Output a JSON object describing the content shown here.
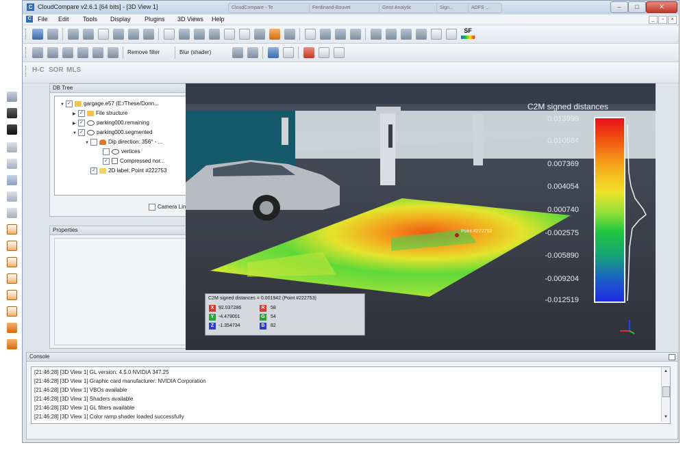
{
  "window": {
    "title": "CloudCompare v2.6.1 [64 bits] - [3D View 1]",
    "app_icon": "C",
    "tabs_behind": [
      "CloudCompare - Te",
      "Ferdinand-Bouvet",
      "Geist Analytic",
      "Sign...",
      "ADFS ..."
    ],
    "minimize_label": "–",
    "maximize_label": "□",
    "close_label": "✕"
  },
  "menu": {
    "items": [
      "File",
      "Edit",
      "Tools",
      "Display",
      "Plugins",
      "3D Views",
      "Help"
    ],
    "mdi_buttons": [
      "_",
      "▫",
      "×"
    ]
  },
  "toolbar2": {
    "remove_filter_label": "Remove filter",
    "blur_label": "Blur (shader)"
  },
  "toolbar3": {
    "plugins": [
      "H-C",
      "SOR",
      "MLS"
    ]
  },
  "toolbar1": {
    "sf_badge": "SF"
  },
  "db_tree": {
    "title": "DB Tree",
    "items": [
      {
        "label": "gargage.e57 (E:/These/Donn...",
        "checked": true,
        "icon": "folder-icon",
        "arrow": "▼"
      },
      {
        "label": "File structure",
        "checked": true,
        "icon": "folder-icon",
        "arrow": "▶"
      },
      {
        "label": "parking000.remaining",
        "checked": true,
        "icon": "cloud-icon",
        "arrow": "▶"
      },
      {
        "label": "parking000.segmented",
        "checked": true,
        "icon": "cloud-icon",
        "arrow": "▼"
      },
      {
        "label": "Dip direction: 356° - ...",
        "checked": false,
        "icon": "dip-icon",
        "arrow": "▼"
      },
      {
        "label": "vertices",
        "checked": false,
        "icon": "cloud-icon",
        "arrow": ""
      },
      {
        "label": "Compressed nor...",
        "checked": true,
        "icon": "mesh-icon",
        "arrow": ""
      },
      {
        "label": "2D label: Point #222753",
        "checked": true,
        "icon": "label-icon",
        "arrow": ""
      }
    ],
    "camera_link_label": "Camera Link"
  },
  "properties": {
    "title": "Properties"
  },
  "view": {
    "point_label": "Point #222753",
    "scale_title": "C2M signed distances",
    "scale_ticks": [
      "0.013999",
      "0.010684",
      "0.007369",
      "0.004054",
      "0.000740",
      "-0.002575",
      "-0.005890",
      "-0.009204",
      "-0.012519"
    ],
    "info": {
      "title": "C2M signed distances = 0.001942 (Point #222753)",
      "rows": [
        {
          "axis": "X",
          "value": "92.037286",
          "channel": "R",
          "channel_value": "58"
        },
        {
          "axis": "Y",
          "value": "-4.479001",
          "channel": "G",
          "channel_value": "54"
        },
        {
          "axis": "Z",
          "value": "-1.354734",
          "channel": "B",
          "channel_value": "82"
        }
      ]
    }
  },
  "console": {
    "title": "Console",
    "lines": [
      "[21:46:28] [3D View 1] GL version: 4.5.0 NVIDIA 347.25",
      "[21:46:28] [3D View 1] Graphic card manufacturer: NVIDIA Corporation",
      "[21:46:28] [3D View 1] VBOs available",
      "[21:46:28] [3D View 1] Shaders available",
      "[21:46:28] [3D View 1] GL filters available",
      "[21:46:28] [3D View 1] Color ramp shader loaded successfully"
    ]
  },
  "colors": {
    "accent": "#2c6fbf",
    "view_background": "#2a3040"
  }
}
